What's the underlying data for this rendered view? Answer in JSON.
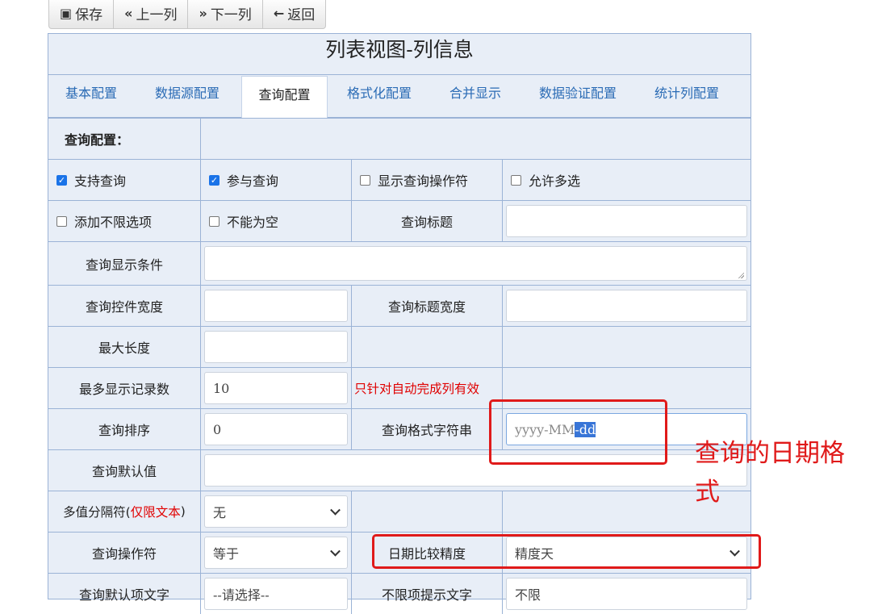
{
  "toolbar": {
    "save_label": "保存",
    "prev_label": "上一列",
    "next_label": "下一列",
    "back_label": "返回"
  },
  "panel": {
    "title": "列表视图-列信息"
  },
  "tabs": [
    "基本配置",
    "数据源配置",
    "查询配置",
    "格式化配置",
    "合并显示",
    "数据验证配置",
    "统计列配置"
  ],
  "active_tab": "查询配置",
  "form": {
    "section_label": "查询配置：",
    "support_query": "支持查询",
    "participate_query": "参与查询",
    "show_query_operator": "显示查询操作符",
    "allow_multi_select": "允许多选",
    "add_unlimited_option": "添加不限选项",
    "not_empty": "不能为空",
    "query_title_label": "查询标题",
    "query_display_condition_label": "查询显示条件",
    "query_control_width_label": "查询控件宽度",
    "query_title_width_label": "查询标题宽度",
    "max_length_label": "最大长度",
    "max_records_label": "最多显示记录数",
    "max_records_value": "10",
    "max_records_hint": "只针对自动完成列有效",
    "query_sort_label": "查询排序",
    "query_sort_value": "0",
    "query_format_label": "查询格式字符串",
    "query_format_value_a": "yyyy-MM",
    "query_format_value_b": "-dd",
    "query_default_label": "查询默认值",
    "multi_sep_label_a": "多值分隔符(",
    "multi_sep_label_b": "仅限文本",
    "multi_sep_label_c": ")",
    "multi_sep_value": "无",
    "query_operator_label": "查询操作符",
    "query_operator_value": "等于",
    "date_precision_label": "日期比较精度",
    "date_precision_value": "精度天",
    "default_item_label": "查询默认项文字",
    "default_item_value": "--请选择--",
    "unlimited_hint_label": "不限项提示文字",
    "unlimited_hint_value": "不限"
  },
  "checkboxes": {
    "support_query": true,
    "participate_query": true,
    "show_query_operator": false,
    "allow_multi_select": false,
    "add_unlimited_option": false,
    "not_empty": false
  },
  "annotation": {
    "note": "查询的日期格式",
    "color": "#e01a1a"
  }
}
